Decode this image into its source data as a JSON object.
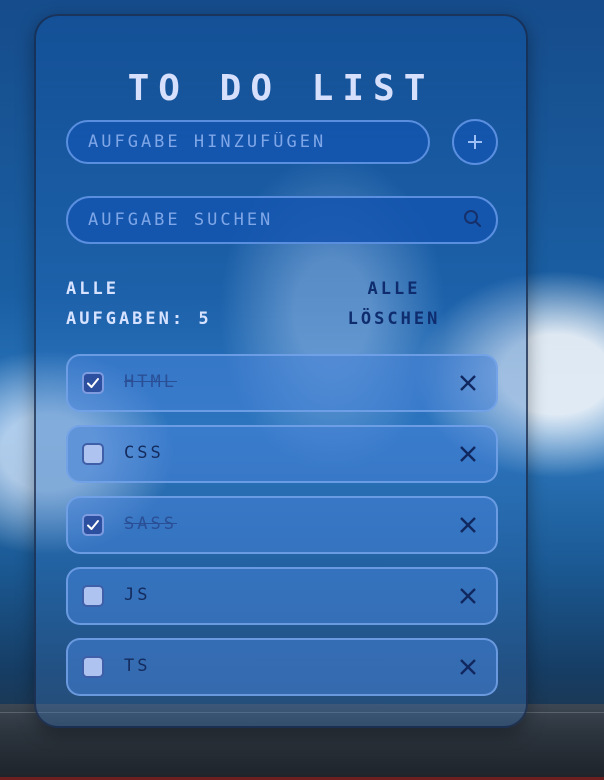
{
  "title": "TO DO LIST",
  "add": {
    "placeholder": "AUFGABE HINZUFÜGEN",
    "button_icon": "plus-icon"
  },
  "search": {
    "placeholder": "AUFGABE SUCHEN",
    "icon": "search-icon"
  },
  "stats": {
    "label_line1": "ALLE",
    "label_line2": "AUFGABEN: 5"
  },
  "clear_all": {
    "line1": "ALLE",
    "line2": "LÖSCHEN"
  },
  "tasks": [
    {
      "text": "HTML",
      "done": true
    },
    {
      "text": "CSS",
      "done": false
    },
    {
      "text": "SASS",
      "done": true
    },
    {
      "text": "JS",
      "done": false
    },
    {
      "text": "TS",
      "done": false
    }
  ],
  "colors": {
    "accent": "#5a8fe0",
    "title": "#d6dffb",
    "clear_text": "#0e2c6e",
    "checkbox_checked": "#2c4f9f"
  }
}
